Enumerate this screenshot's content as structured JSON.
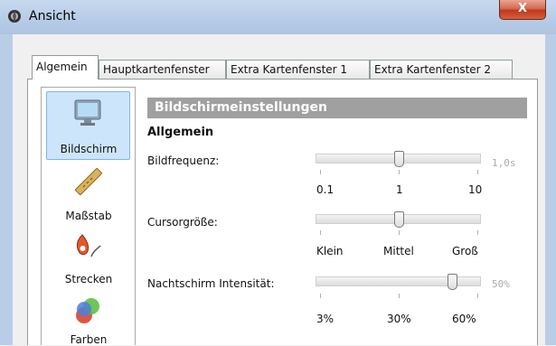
{
  "window": {
    "title": "Ansicht",
    "close_label": "X"
  },
  "tabs": [
    {
      "label": "Algemein",
      "active": true
    },
    {
      "label": "Hauptkartenfenster",
      "active": false
    },
    {
      "label": "Extra Kartenfenster 1",
      "active": false
    },
    {
      "label": "Extra Kartenfenster 2",
      "active": false
    }
  ],
  "categories": [
    {
      "label": "Bildschirm",
      "icon": "monitor-icon",
      "selected": true
    },
    {
      "label": "Maßstab",
      "icon": "ruler-icon",
      "selected": false
    },
    {
      "label": "Strecken",
      "icon": "route-pin-icon",
      "selected": false
    },
    {
      "label": "Farben",
      "icon": "color-circles-icon",
      "selected": false
    }
  ],
  "section": {
    "title": "Bildschirmeinstellungen",
    "subtitle": "Allgemein"
  },
  "settings": {
    "frame_rate": {
      "label": "Bildfrequenz:",
      "value_text": "1,0s",
      "ticks": [
        "0.1",
        "1",
        "10"
      ],
      "position": 0.5
    },
    "cursor_size": {
      "label": "Cursorgröße:",
      "ticks": [
        "Klein",
        "Mittel",
        "Groß"
      ],
      "position": 0.5
    },
    "night_intensity": {
      "label": "Nachtschirm Intensität:",
      "value_text": "50%",
      "ticks": [
        "3%",
        "30%",
        "60%"
      ],
      "position": 0.82
    }
  },
  "colors": {
    "selection_bg": "#cde5fb",
    "header_bg": "#a0a0a0",
    "close_red": "#c0381c"
  }
}
